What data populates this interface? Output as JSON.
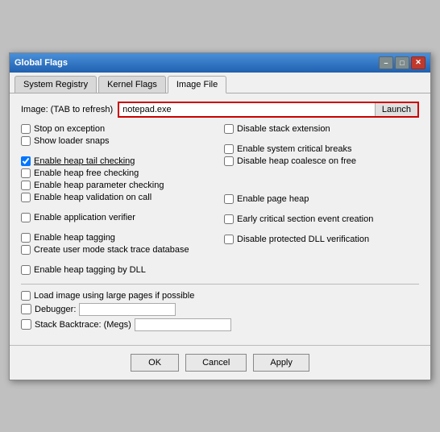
{
  "window": {
    "title": "Global Flags",
    "close_label": "✕",
    "min_label": "–",
    "max_label": "□"
  },
  "tabs": [
    {
      "label": "System Registry",
      "active": false
    },
    {
      "label": "Kernel Flags",
      "active": false
    },
    {
      "label": "Image File",
      "active": true
    }
  ],
  "image_section": {
    "label": "Image: (TAB to refresh)",
    "input_value": "notepad.exe",
    "launch_label": "Launch"
  },
  "left_col": {
    "items": [
      {
        "label": "Stop on exception",
        "checked": false
      },
      {
        "label": "Show loader snaps",
        "checked": false
      }
    ],
    "gap": true,
    "items2": [
      {
        "label": "Enable heap tail checking",
        "checked": true,
        "underline": true
      },
      {
        "label": "Enable heap free checking",
        "checked": false
      },
      {
        "label": "Enable heap parameter checking",
        "checked": false
      },
      {
        "label": "Enable heap validation on call",
        "checked": false
      }
    ],
    "gap2": true,
    "items3": [
      {
        "label": "Enable application verifier",
        "checked": false
      }
    ],
    "gap3": true,
    "items4": [
      {
        "label": "Enable heap tagging",
        "checked": false
      },
      {
        "label": "Create user mode stack trace database",
        "checked": false
      }
    ],
    "gap4": true,
    "items5": [
      {
        "label": "Enable heap tagging by DLL",
        "checked": false
      }
    ]
  },
  "right_col": {
    "items": [
      {
        "label": "Disable stack extension",
        "checked": false
      }
    ],
    "gap": true,
    "items2": [
      {
        "label": "Enable system critical breaks",
        "checked": false
      },
      {
        "label": "Disable heap coalesce on free",
        "checked": false
      }
    ],
    "gap2": true,
    "items3": [
      {
        "label": "Enable page heap",
        "checked": false
      }
    ],
    "gap3": true,
    "items4": [
      {
        "label": "Early critical section event creation",
        "checked": false
      }
    ],
    "gap4": true,
    "items5": [
      {
        "label": "Disable protected DLL verification",
        "checked": false
      }
    ]
  },
  "bottom_section": {
    "items": [
      {
        "label": "Load image using large pages if possible",
        "checked": false
      },
      {
        "label": "Debugger:",
        "checked": false,
        "has_input": true
      },
      {
        "label": "Stack Backtrace: (Megs)",
        "checked": false,
        "has_input": true
      }
    ]
  },
  "footer": {
    "ok_label": "OK",
    "cancel_label": "Cancel",
    "apply_label": "Apply"
  }
}
